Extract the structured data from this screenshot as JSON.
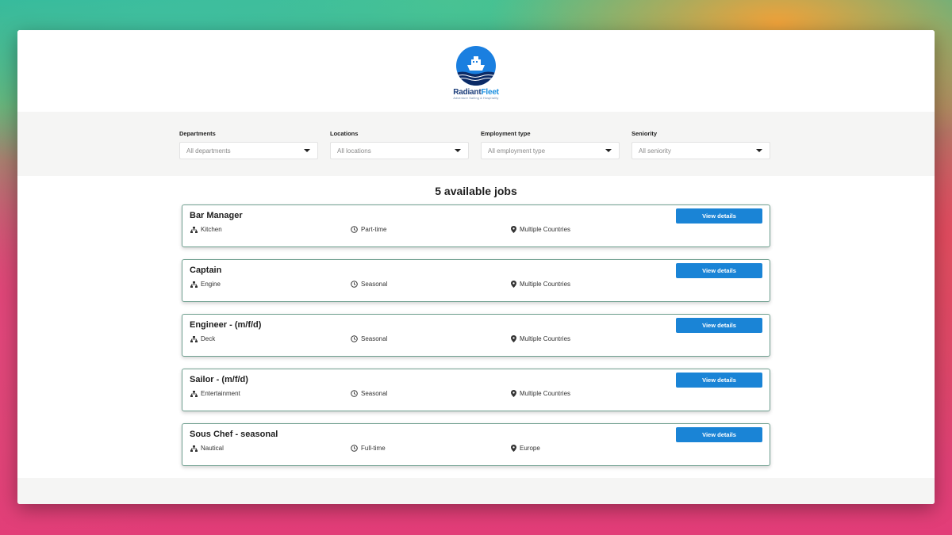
{
  "brand": {
    "name_part1": "Radiant",
    "name_part2": "Fleet",
    "tagline": "Adventure Sailing & Hospitality",
    "primary_color": "#1a7fe0"
  },
  "filters": [
    {
      "label": "Departments",
      "value": "All departments"
    },
    {
      "label": "Locations",
      "value": "All locations"
    },
    {
      "label": "Employment type",
      "value": "All employment type"
    },
    {
      "label": "Seniority",
      "value": "All seniority"
    }
  ],
  "results": {
    "count_text": "5 available jobs",
    "button_label": "View details",
    "accent_color": "#1a84d6",
    "jobs": [
      {
        "title": "Bar Manager",
        "department": "Kitchen",
        "type": "Part-time",
        "location": "Multiple Countries"
      },
      {
        "title": "Captain",
        "department": "Engine",
        "type": "Seasonal",
        "location": "Multiple Countries"
      },
      {
        "title": "Engineer - (m/f/d)",
        "department": "Deck",
        "type": "Seasonal",
        "location": "Multiple Countries"
      },
      {
        "title": "Sailor - (m/f/d)",
        "department": "Entertainment",
        "type": "Seasonal",
        "location": "Multiple Countries"
      },
      {
        "title": "Sous Chef - seasonal",
        "department": "Nautical",
        "type": "Full-time",
        "location": "Europe"
      }
    ]
  },
  "icons": {
    "department": "sitemap-icon",
    "type": "clock-icon",
    "location": "map-pin-icon",
    "select": "caret-down-icon"
  }
}
